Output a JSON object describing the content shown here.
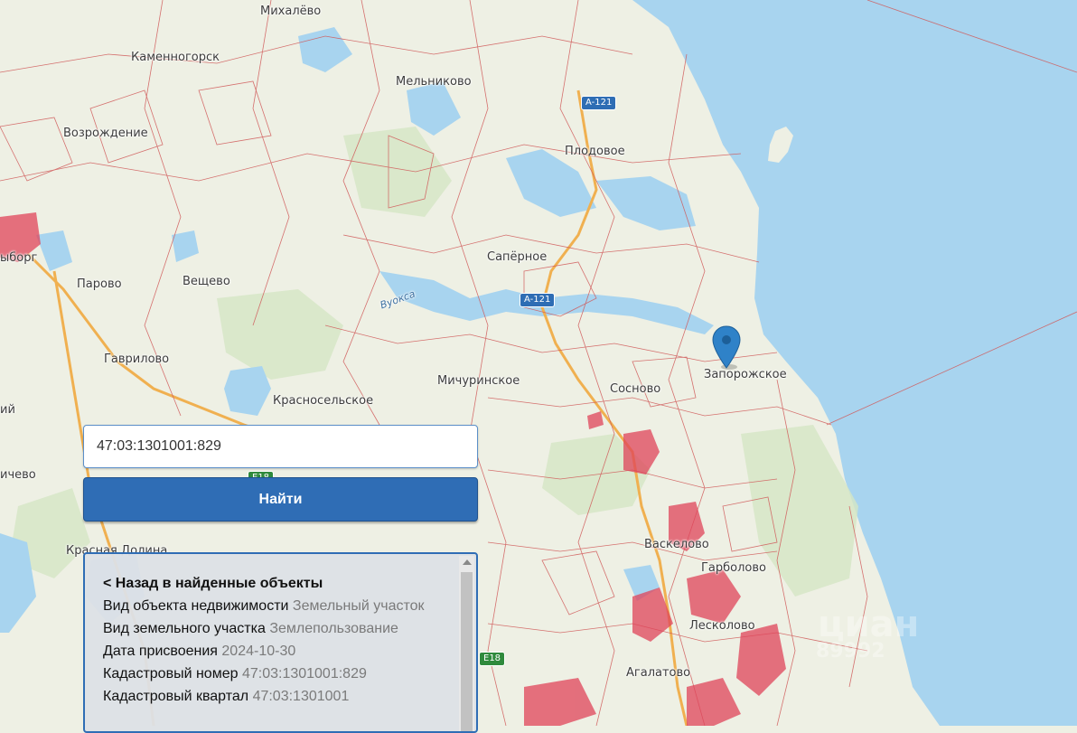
{
  "map": {
    "places": [
      {
        "id": "mikhalevo",
        "label": "Михалёво"
      },
      {
        "id": "kamennogorsk",
        "label": "Каменногорск"
      },
      {
        "id": "melnikovo",
        "label": "Мельниково"
      },
      {
        "id": "vozrozhdenie",
        "label": "Возрождение"
      },
      {
        "id": "plodovoe",
        "label": "Плодовое"
      },
      {
        "id": "vyborg",
        "label": "ыборг"
      },
      {
        "id": "sapernoe",
        "label": "Сапёрное"
      },
      {
        "id": "parovo",
        "label": "Парово"
      },
      {
        "id": "veshchevo",
        "label": "Вещево"
      },
      {
        "id": "zaporozhskoe",
        "label": "Запорожское"
      },
      {
        "id": "gavrilovo",
        "label": "Гаврилово"
      },
      {
        "id": "michurinskoe",
        "label": "Мичуринское"
      },
      {
        "id": "sosnovo",
        "label": "Сосново"
      },
      {
        "id": "krasnoselskoe",
        "label": "Красносельское"
      },
      {
        "id": "yi",
        "label": "ий"
      },
      {
        "id": "chevo",
        "label": "ичево"
      },
      {
        "id": "vaskelovo",
        "label": "Васкелово"
      },
      {
        "id": "garbolovo",
        "label": "Гарболово"
      },
      {
        "id": "leskolovo",
        "label": "Лесколово"
      },
      {
        "id": "agalatovo",
        "label": "Агалатово"
      },
      {
        "id": "vuoksa",
        "label": "Вуокса"
      },
      {
        "id": "krasnaya",
        "label": "Красная Долина"
      }
    ],
    "shields": [
      {
        "id": "a121-top",
        "label": "A-121"
      },
      {
        "id": "a121-mid",
        "label": "A-121"
      },
      {
        "id": "e18-left",
        "label": "E18"
      },
      {
        "id": "e18-bottom",
        "label": "E18"
      }
    ],
    "watermark": "циан",
    "watermark_sub": "89992",
    "colors": {
      "water": "#a8d4ef",
      "land": "#eef0e4",
      "forest": "#cfe3bf",
      "boundary": "#d05a5a",
      "urban": "#e0445a",
      "road": "#f0a040"
    }
  },
  "search": {
    "value": "47:03:1301001:829",
    "button_label": "Найти"
  },
  "result": {
    "back_label": "< Назад в найденные объекты",
    "rows": [
      {
        "label": "Вид объекта недвижимости",
        "value": "Земельный участок"
      },
      {
        "label": "Вид земельного участка",
        "value": "Землепользование"
      },
      {
        "label": "Дата присвоения",
        "value": "2024-10-30"
      },
      {
        "label": "Кадастровый номер",
        "value": "47:03:1301001:829"
      },
      {
        "label": "Кадастровый квартал",
        "value": "47:03:1301001"
      }
    ]
  }
}
